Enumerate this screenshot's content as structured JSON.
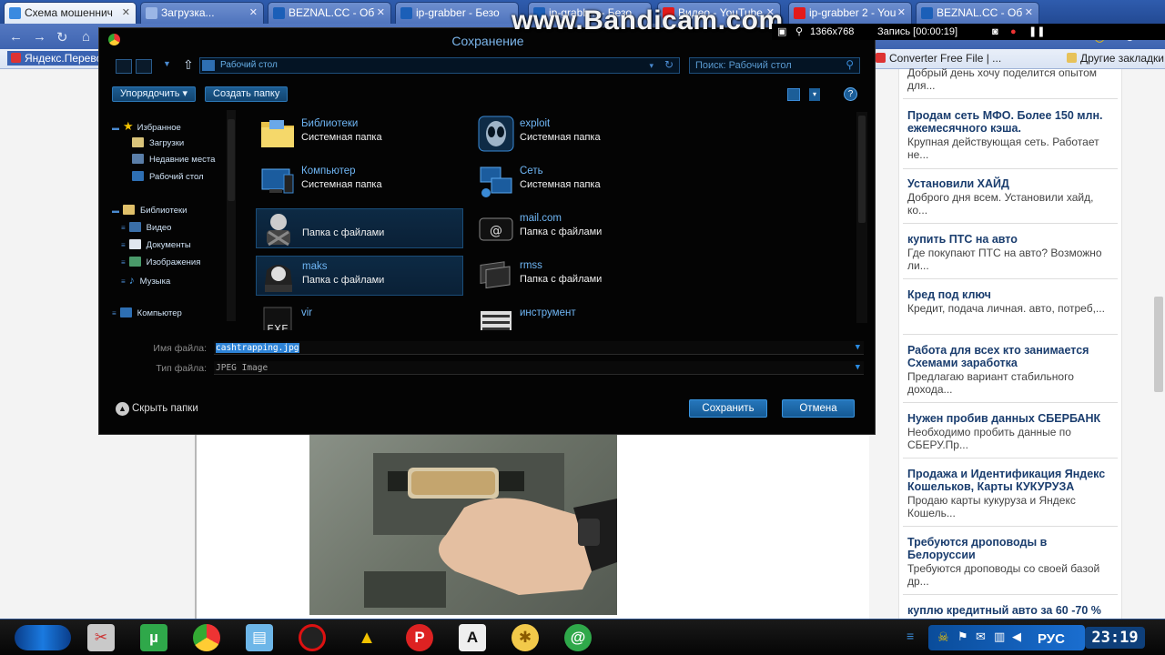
{
  "browser": {
    "tabs": [
      {
        "label": "Схема мошеннич",
        "icon": "page-icon",
        "active": true
      },
      {
        "label": "Загрузка...",
        "icon": "page-icon",
        "active": false
      },
      {
        "label": "BEZNAL.CC - Об",
        "icon": "page-icon",
        "active": false
      },
      {
        "label": "ip-grabber - Безо",
        "icon": "page-icon",
        "active": false
      },
      {
        "label": "ip-grabb... - Безо",
        "icon": "page-icon",
        "active": false
      },
      {
        "label": "Видео - YouTube",
        "icon": "youtube-icon",
        "active": false
      },
      {
        "label": "ip-grabber 2 - You",
        "icon": "youtube-icon",
        "active": false
      },
      {
        "label": "BEZNAL.CC - Об",
        "icon": "page-icon",
        "active": false
      }
    ],
    "bookmarks": {
      "left": "Яндекс.Перевод",
      "converter": "Converter Free File | ...",
      "other": "Другие закладки"
    }
  },
  "recorder": {
    "watermark": "www.Bandicam.com",
    "resolution": "1366x768",
    "recording": "Запись [00:00:19]"
  },
  "dialog": {
    "title": "Сохранение",
    "address": "Рабочий стол",
    "search_placeholder": "Поиск: Рабочий стол",
    "organize_label": "Упорядочить ▾",
    "new_folder_label": "Создать папку",
    "nav": {
      "favorites": "Избранное",
      "downloads": "Загрузки",
      "recent": "Недавние места",
      "desktop": "Рабочий стол",
      "libraries": "Библиотеки",
      "video": "Видео",
      "documents": "Документы",
      "images": "Изображения",
      "music": "Музыка",
      "computer": "Компьютер"
    },
    "files": [
      {
        "name": "Библиотеки",
        "type": "Системная папка",
        "icon": "libraries-folder-icon"
      },
      {
        "name": "exploit",
        "type": "Системная папка",
        "icon": "alien-icon"
      },
      {
        "name": "Компьютер",
        "type": "Системная папка",
        "icon": "computer-icon"
      },
      {
        "name": "Сеть",
        "type": "Системная папка",
        "icon": "network-icon"
      },
      {
        "name": "",
        "type": "Папка с файлами",
        "icon": "user-folder-icon"
      },
      {
        "name": "mail.com",
        "type": "Папка с файлами",
        "icon": "mail-folder-icon"
      },
      {
        "name": "maks",
        "type": "Папка с файлами",
        "icon": "user-folder-icon"
      },
      {
        "name": "rmss",
        "type": "Папка с файлами",
        "icon": "folder-icon"
      },
      {
        "name": "vir",
        "type": "",
        "icon": "exe-icon"
      },
      {
        "name": "инструмент",
        "type": "",
        "icon": "tools-folder-icon"
      }
    ],
    "filename_label": "Имя файла:",
    "filename_value": "cashtrapping.jpg",
    "filetype_label": "Тип файла:",
    "filetype_value": "JPEG Image",
    "hide_folders": "Скрыть папки",
    "save_button": "Сохранить",
    "cancel_button": "Отмена"
  },
  "sidebar_news": [
    {
      "title": "",
      "desc": "Добрый день хочу поделится опытом для..."
    },
    {
      "title": "Продам сеть МФО. Более 150 млн. ежемесячного кэша.",
      "desc": "Крупная действующая сеть. Работает не..."
    },
    {
      "title": "Установили ХАЙД",
      "desc": "Доброго дня всем. Установили хайд, ко..."
    },
    {
      "title": "купить ПТС на авто",
      "desc": "Где покупают ПТС на авто? Возможно ли..."
    },
    {
      "title": "Кред под ключ",
      "desc": "Кредит, подача личная. авто, потреб,..."
    },
    {
      "title": "Работа для всех кто занимается Схемами заработка",
      "desc": "Предлагаю вариант стабильного дохода..."
    },
    {
      "title": "Нужен пробив данных СБЕРБАНК",
      "desc": "Необходимо пробить данные по СБЕРУ.Пр..."
    },
    {
      "title": "Продажа и Идентификация Яндекс Кошельков, Карты КУКУРУЗА",
      "desc": "Продаю карты кукуруза и Яндекс Кошель..."
    },
    {
      "title": "Требуются дроповоды в Белоруссии",
      "desc": "Требуются дроповоды со своей базой др..."
    },
    {
      "title": "куплю кредитный авто за 60 -70 %",
      "desc": ""
    }
  ],
  "taskbar": {
    "language": "РУС",
    "time": "23:19"
  },
  "colors": {
    "dialog_bg": "#040404",
    "dialog_accent": "#2e83d6",
    "news_title": "#1a3d6e",
    "taskbar_bg": "#050505"
  }
}
